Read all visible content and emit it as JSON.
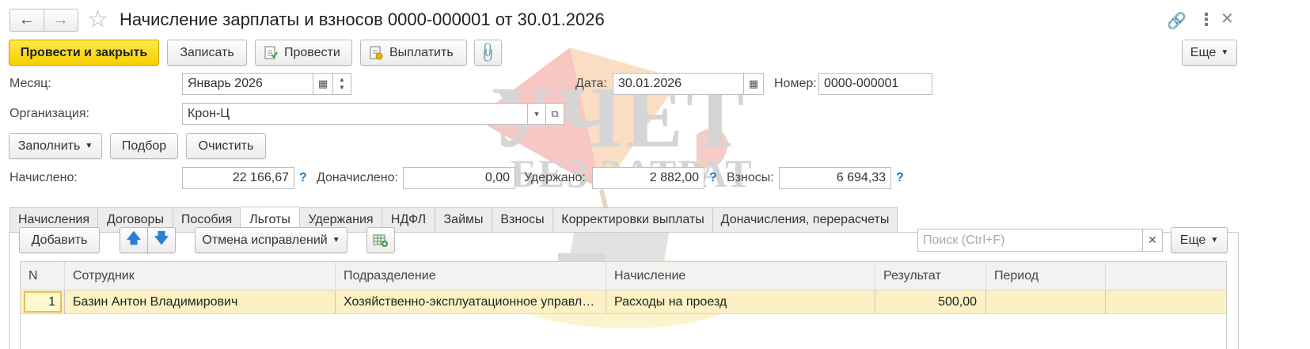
{
  "window": {
    "title": "Начисление зарплаты и взносов 0000-000001 от 30.01.2026"
  },
  "toolbar": {
    "post_close": "Провести и закрыть",
    "save": "Записать",
    "post": "Провести",
    "pay": "Выплатить",
    "more": "Еще"
  },
  "header": {
    "month_label": "Месяц:",
    "month_value": "Январь 2026",
    "date_label": "Дата:",
    "date_value": "30.01.2026",
    "number_label": "Номер:",
    "number_value": "0000-000001",
    "org_label": "Организация:",
    "org_value": "Крон-Ц"
  },
  "actions": {
    "fill": "Заполнить",
    "select": "Подбор",
    "clear": "Очистить"
  },
  "totals": {
    "accrued_label": "Начислено:",
    "accrued_value": "22 166,67",
    "extra_label": "Доначислено:",
    "extra_value": "0,00",
    "withheld_label": "Удержано:",
    "withheld_value": "2 882,00",
    "contrib_label": "Взносы:",
    "contrib_value": "6 694,33",
    "help": "?"
  },
  "tabs": [
    "Начисления",
    "Договоры",
    "Пособия",
    "Льготы",
    "Удержания",
    "НДФЛ",
    "Займы",
    "Взносы",
    "Корректировки выплаты",
    "Доначисления, перерасчеты"
  ],
  "active_tab": "Льготы",
  "table_toolbar": {
    "add": "Добавить",
    "undo_fix": "Отмена исправлений",
    "search_placeholder": "Поиск (Ctrl+F)",
    "more": "Еще"
  },
  "table": {
    "columns": [
      "N",
      "Сотрудник",
      "Подразделение",
      "Начисление",
      "Результат",
      "Период"
    ],
    "rows": [
      {
        "n": "1",
        "employee": "Базин Антон Владимирович",
        "department": "Хозяйственно-эксплуатационное управл…",
        "accrual": "Расходы на проезд",
        "result": "500,00",
        "period": ""
      }
    ]
  },
  "watermark": {
    "line1": "УЧЕТ",
    "line2": "БЕЗ ЗАТРАТ"
  },
  "colors": {
    "primary_button": "#f5d000",
    "selected_row": "#fbf1c4",
    "help_link": "#1d7bc6",
    "nav_arrow": "#2a7fd4"
  }
}
